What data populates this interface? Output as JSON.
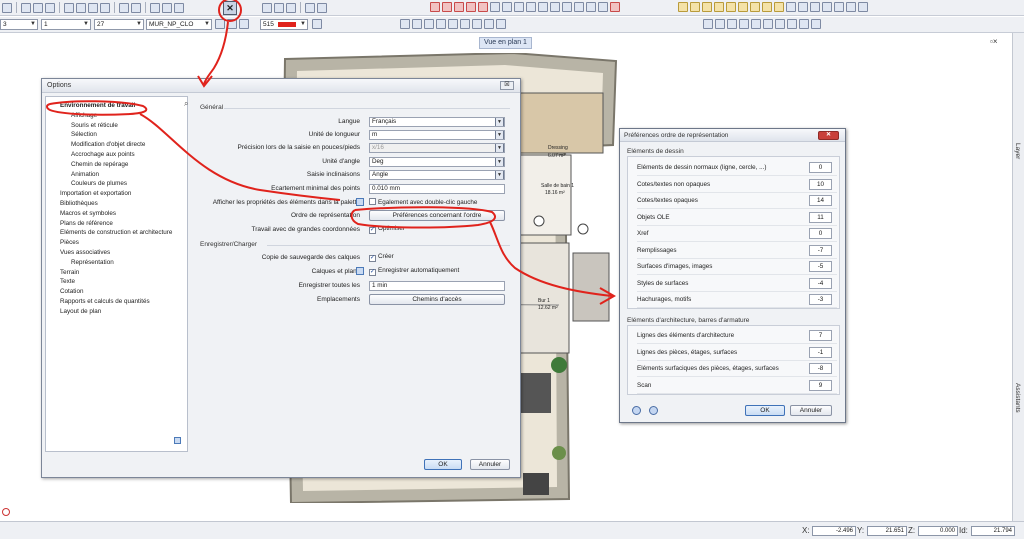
{
  "toolbar": {
    "line_weight_combo": "1",
    "line_type_combo": "27",
    "layer_combo": "MUR_NP_CLO",
    "pen_combo": "515",
    "pen_color": "#e0231c",
    "left_combo": "3",
    "selected_tool_glyph": "✕"
  },
  "viewport": {
    "label": "Vue en plan 1",
    "restore_glyph": "▫×"
  },
  "right_rail": {
    "tab_top": "Layer",
    "tab_bottom": "Assistants"
  },
  "options": {
    "title": "Options",
    "close_label": "☒",
    "tree": [
      {
        "label": "Environnement de travail",
        "level": 0,
        "selected": true
      },
      {
        "label": "Affichage",
        "level": 1
      },
      {
        "label": "Souris et réticule",
        "level": 1
      },
      {
        "label": "Sélection",
        "level": 1
      },
      {
        "label": "Modification d'objet directe",
        "level": 1
      },
      {
        "label": "Accrochage aux points",
        "level": 1
      },
      {
        "label": "Chemin de repérage",
        "level": 1
      },
      {
        "label": "Animation",
        "level": 1
      },
      {
        "label": "Couleurs de plumes",
        "level": 1
      },
      {
        "label": "Importation et exportation",
        "level": 0
      },
      {
        "label": "Bibliothèques",
        "level": 0
      },
      {
        "label": "Macros et symboles",
        "level": 0
      },
      {
        "label": "Plans de référence",
        "level": 0
      },
      {
        "label": "Eléments de construction et architecture",
        "level": 0
      },
      {
        "label": "Pièces",
        "level": 0
      },
      {
        "label": "Vues associatives",
        "level": 0
      },
      {
        "label": "Représentation",
        "level": 1
      },
      {
        "label": "Terrain",
        "level": 0
      },
      {
        "label": "Texte",
        "level": 0
      },
      {
        "label": "Cotation",
        "level": 0
      },
      {
        "label": "Rapports et calculs de quantités",
        "level": 0
      },
      {
        "label": "Layout de plan",
        "level": 0
      }
    ],
    "general": {
      "section": "Général",
      "langue_label": "Langue",
      "langue_value": "Français",
      "longueur_label": "Unité de longueur",
      "longueur_value": "m",
      "precision_label": "Précision lors de la saisie en pouces/pieds",
      "precision_value": "x/16",
      "angle_label": "Unité d'angle",
      "angle_value": "Deg",
      "inclinaison_label": "Saisie inclinaisons",
      "inclinaison_value": "Angle",
      "ecartement_label": "Ecartement minimal des points",
      "ecartement_value": "0.010 mm",
      "proprietes_label": "Afficher les propriétés des éléments dans la palette",
      "proprietes_check": "Egalement avec double-clic gauche",
      "ordre_label": "Ordre de représentation",
      "ordre_button": "Préférences concernant l'ordre",
      "coords_label": "Travail avec de grandes coordonnées",
      "coords_check": "Optimiser"
    },
    "save": {
      "section": "Enregistrer/Charger",
      "copie_label": "Copie de sauvegarde des calques",
      "copie_check": "Créer",
      "calques_label": "Calques et plans",
      "calques_check": "Enregistrer automatiquement",
      "toutes_label": "Enregistrer toutes les",
      "toutes_value": "1 min",
      "emplacements_label": "Emplacements",
      "emplacements_button": "Chemins d'accès"
    },
    "ok": "OK",
    "cancel": "Annuler"
  },
  "prefs": {
    "title": "Préférences ordre de représentation",
    "close_label": "✕",
    "group1_title": "Eléments de dessin",
    "group1": [
      {
        "label": "Eléments de dessin normaux (ligne, cercle, ...)",
        "value": "0"
      },
      {
        "label": "Cotes/textes non opaques",
        "value": "10"
      },
      {
        "label": "Cotes/textes opaques",
        "value": "14"
      },
      {
        "label": "Objets OLE",
        "value": "11"
      },
      {
        "label": "Xref",
        "value": "0"
      },
      {
        "label": "Remplissages",
        "value": "-7"
      },
      {
        "label": "Surfaces d'images, images",
        "value": "-5"
      },
      {
        "label": "Styles de surfaces",
        "value": "-4"
      },
      {
        "label": "Hachurages, motifs",
        "value": "-3"
      }
    ],
    "group2_title": "Eléments d'architecture, barres d'armature",
    "group2": [
      {
        "label": "Lignes des éléments d'architecture",
        "value": "7"
      },
      {
        "label": "Lignes des pièces, étages, surfaces",
        "value": "-1"
      },
      {
        "label": "Eléments surfaciques des pièces, étages, surfaces",
        "value": "-8"
      },
      {
        "label": "Scan",
        "value": "9"
      }
    ],
    "ok": "OK",
    "cancel": "Annuler"
  },
  "plan": {
    "room1_name": "Dressing",
    "room1_area": "6.07 m²",
    "room2_name": "Salle de bain 1",
    "room2_area": "18.16 m²",
    "room3_name": "Bur 1",
    "room3_area": "12.62 m²"
  },
  "status": {
    "x_label": "X:",
    "x_value": "-2.496",
    "y_label": "Y:",
    "y_value": "21.651",
    "z_label": "Z:",
    "z_value": "0.000",
    "d_label": "Id:",
    "d_value": "21.794"
  },
  "colors": {
    "annotation_red": "#e0231c",
    "selected_tree": "#000000"
  }
}
